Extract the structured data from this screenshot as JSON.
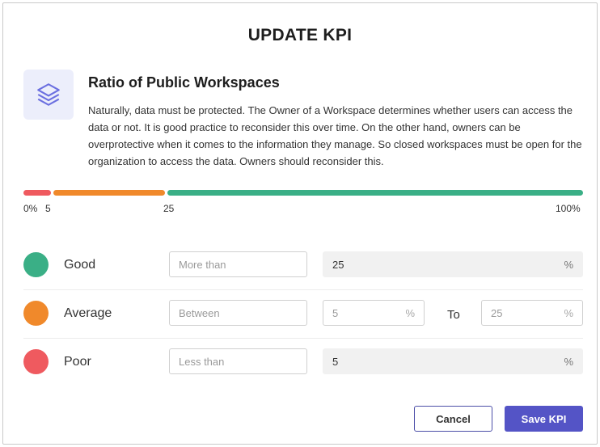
{
  "dialog": {
    "title": "UPDATE KPI"
  },
  "kpi": {
    "icon": "layers-icon",
    "name": "Ratio of Public Workspaces",
    "description": "Naturally, data must be protected. The Owner of a Workspace determines whether users can access the data or not. It is good practice to reconsider this over time. On the other hand, owners can be overprotective when it comes to the information they manage. So closed workspaces must be open for the organization to access the data. Owners should reconsider this."
  },
  "scale": {
    "ticks": [
      "0%",
      "5",
      "25",
      "100%"
    ],
    "segments": [
      {
        "name": "Poor",
        "from": 0,
        "to": 5,
        "color": "#ef5a5f"
      },
      {
        "name": "Average",
        "from": 5,
        "to": 25,
        "color": "#f0892b"
      },
      {
        "name": "Good",
        "from": 25,
        "to": 100,
        "color": "#3aaf86"
      }
    ]
  },
  "rows": {
    "good": {
      "label": "Good",
      "color": "#3aaf86",
      "condition_placeholder": "More than",
      "value": "25",
      "unit": "%"
    },
    "average": {
      "label": "Average",
      "color": "#f0892b",
      "condition_placeholder": "Between",
      "from_value": "5",
      "to_label": "To",
      "to_value": "25",
      "unit": "%"
    },
    "poor": {
      "label": "Poor",
      "color": "#ef5a5f",
      "condition_placeholder": "Less than",
      "value": "5",
      "unit": "%"
    }
  },
  "buttons": {
    "cancel": "Cancel",
    "save": "Save KPI"
  }
}
